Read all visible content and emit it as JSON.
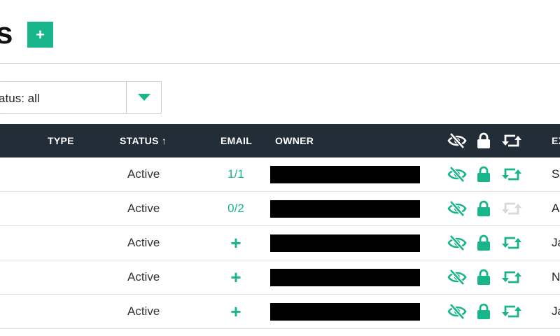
{
  "page": {
    "title": "s",
    "add_label": "+"
  },
  "filter": {
    "label": "Status: all"
  },
  "colors": {
    "accent": "#19b58a",
    "header_bg": "#232d38",
    "muted_icon": "#d8d8d8"
  },
  "table": {
    "headers": {
      "type": "TYPE",
      "status": "STATUS ↑",
      "email": "EMAIL",
      "owner": "OWNER",
      "hidden_icon": "eye-slash-icon",
      "locked_icon": "lock-icon",
      "autorenew_icon": "retweet-icon",
      "expiry": "EX"
    },
    "rows": [
      {
        "status": "Active",
        "email": "1/1",
        "hidden": true,
        "locked": true,
        "autorenew": true,
        "expiry": "Se"
      },
      {
        "status": "Active",
        "email": "0/2",
        "hidden": true,
        "locked": true,
        "autorenew": false,
        "expiry": "A"
      },
      {
        "status": "Active",
        "email": "+",
        "hidden": true,
        "locked": true,
        "autorenew": true,
        "expiry": "Ja"
      },
      {
        "status": "Active",
        "email": "+",
        "hidden": true,
        "locked": true,
        "autorenew": true,
        "expiry": "N"
      },
      {
        "status": "Active",
        "email": "+",
        "hidden": true,
        "locked": true,
        "autorenew": true,
        "expiry": "Ja"
      }
    ]
  }
}
